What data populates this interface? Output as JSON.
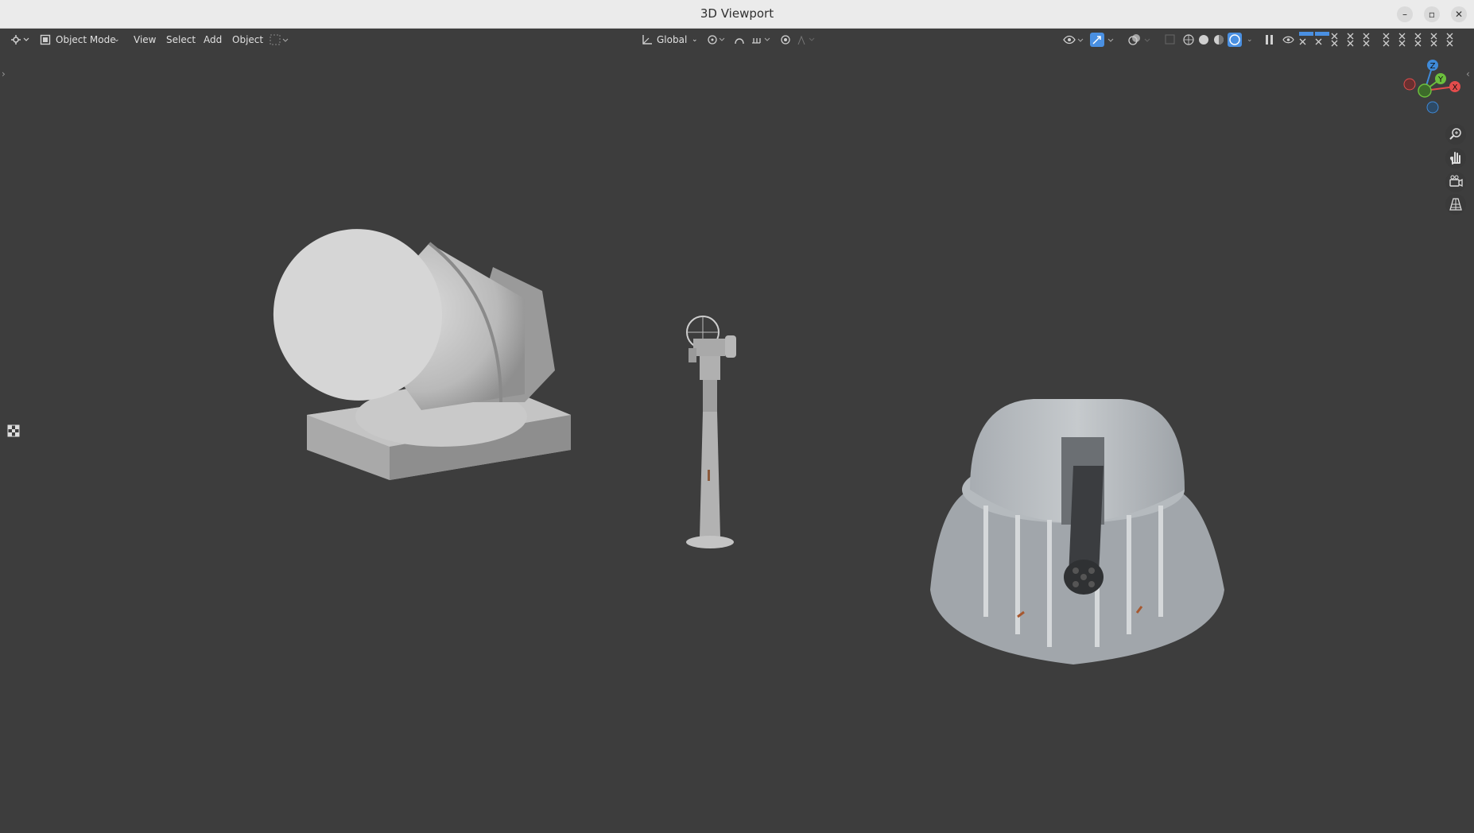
{
  "window": {
    "title": "3D Viewport",
    "controls": {
      "minimize": "–",
      "maximize": "▫",
      "close": "✕"
    }
  },
  "header": {
    "editor_type_icon": "editor-type-icon",
    "mode_label": "Object Mode",
    "menus": {
      "view": "View",
      "select": "Select",
      "add": "Add",
      "object": "Object"
    },
    "transform_orientation": "Global"
  },
  "colors": {
    "viewport_bg": "#3d3d3d",
    "header_text": "#e0e0e0",
    "active_blue": "#4a90e2",
    "axis_x": "#e34c4c",
    "axis_y": "#6cbf3d",
    "axis_z": "#3f8ad8"
  },
  "gizmo": {
    "z": "Z",
    "y": "Y",
    "x": "X"
  },
  "objects": [
    "searchlight",
    "sight-pedestal",
    "gun-turret"
  ]
}
